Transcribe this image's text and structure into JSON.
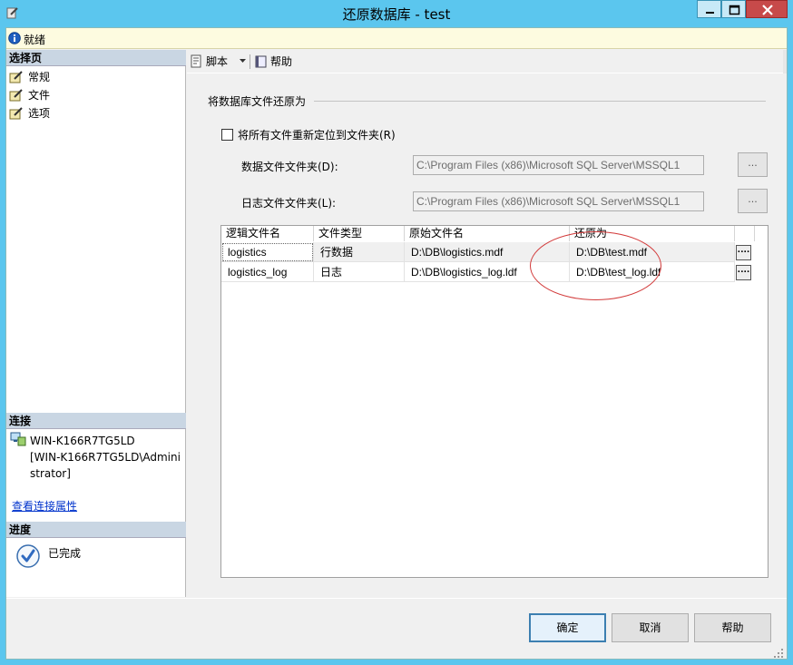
{
  "window": {
    "title": "还原数据库 - test"
  },
  "status": {
    "text": "就绪"
  },
  "left": {
    "select_page_label": "选择页",
    "pages": [
      {
        "label": "常规"
      },
      {
        "label": "文件"
      },
      {
        "label": "选项"
      }
    ],
    "connection_label": "连接",
    "connection_lines": [
      "WIN-K166R7TG5LD",
      "[WIN-K166R7TG5LD\\Admini",
      "strator]"
    ],
    "connection_link": "查看连接属性",
    "progress_label": "进度",
    "progress_text": "已完成"
  },
  "toolbar": {
    "script_label": "脚本",
    "help_label": "帮助"
  },
  "content": {
    "group_title": "将数据库文件还原为",
    "relocate_label": "将所有文件重新定位到文件夹(R)",
    "relocate_checked": false,
    "data_folder_label": "数据文件文件夹(D):",
    "data_folder_value": "C:\\Program Files (x86)\\Microsoft SQL Server\\MSSQL1",
    "log_folder_label": "日志文件文件夹(L):",
    "log_folder_value": "C:\\Program Files (x86)\\Microsoft SQL Server\\MSSQL1",
    "browse_label": "...",
    "grid": {
      "columns": [
        "逻辑文件名",
        "文件类型",
        "原始文件名",
        "还原为"
      ],
      "rows": [
        [
          "logistics",
          "行数据",
          "D:\\DB\\logistics.mdf",
          "D:\\DB\\test.mdf"
        ],
        [
          "logistics_log",
          "日志",
          "D:\\DB\\logistics_log.ldf",
          "D:\\DB\\test_log.ldf"
        ]
      ],
      "row_button_label": "...."
    }
  },
  "buttons": {
    "ok": "确定",
    "cancel": "取消",
    "help": "帮助"
  },
  "colors": {
    "titlebar": "#5bc6ee",
    "annotation": "#d23a3a",
    "link": "#0033cc"
  },
  "icons": [
    "info-icon",
    "page-icon",
    "connection-icon",
    "checkmark-icon",
    "script-icon",
    "help-icon"
  ]
}
